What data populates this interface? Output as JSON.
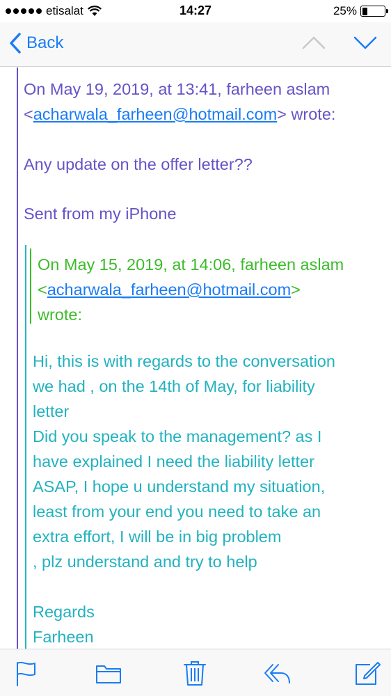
{
  "status_bar": {
    "carrier": "etisalat",
    "time": "14:27",
    "battery_text": "25%",
    "battery_level": 0.25
  },
  "nav": {
    "back_label": "Back",
    "prev_icon": "chevron-up-icon",
    "next_icon": "chevron-down-icon"
  },
  "email": {
    "quote1": {
      "header_line1": "On May 19, 2019, at 13:41, farheen aslam",
      "header_open": "<",
      "header_email": "acharwala_farheen@hotmail.com",
      "header_close": "> wrote:",
      "body_line1": "Any update on the offer letter??",
      "signature": "Sent from my iPhone"
    },
    "quote3": {
      "header_line1": "On May 15, 2019, at 14:06, farheen aslam",
      "header_open": "<",
      "header_email": "acharwala_farheen@hotmail.com",
      "header_close": ">",
      "header_line3": "wrote:"
    },
    "quote2": {
      "lines": [
        "Hi, this is with regards to the conversation",
        "we had , on the 14th of May, for liability",
        "letter",
        "Did you speak to the management? as I",
        "have explained I need the liability letter",
        "ASAP, I hope u understand my situation,",
        "least from your end you need to take an",
        "extra effort, I will be in  big problem",
        ", plz understand and try to help"
      ],
      "closing": "Regards",
      "name": "Farheen"
    }
  },
  "toolbar": {
    "icons": [
      "flag-icon",
      "folder-icon",
      "trash-icon",
      "reply-icon",
      "compose-icon"
    ]
  },
  "colors": {
    "accent": "#1a7cf5",
    "quote1": "#6653c6",
    "quote2": "#22b2bf",
    "quote3": "#3cbc2a"
  }
}
